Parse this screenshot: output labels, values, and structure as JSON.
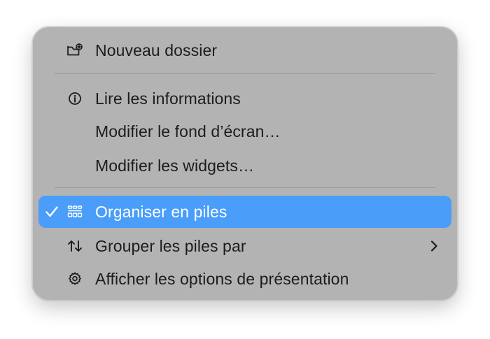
{
  "menu": {
    "items": [
      {
        "label": "Nouveau dossier",
        "icon": "new-folder-icon"
      },
      {
        "label": "Lire les informations",
        "icon": "info-icon"
      },
      {
        "label": "Modifier le fond d’écran…"
      },
      {
        "label": "Modifier les widgets…"
      },
      {
        "label": "Organiser en piles",
        "icon": "stacks-icon",
        "checked": true,
        "highlighted": true
      },
      {
        "label": "Grouper les piles par",
        "icon": "sort-arrows-icon",
        "submenu": true
      },
      {
        "label": "Afficher les options de présentation",
        "icon": "gear-icon"
      }
    ]
  },
  "colors": {
    "menu_background": "#b3b3b3",
    "highlight": "#4a9df8",
    "text": "#1c1c1c",
    "separator": "#9a9a9a"
  }
}
